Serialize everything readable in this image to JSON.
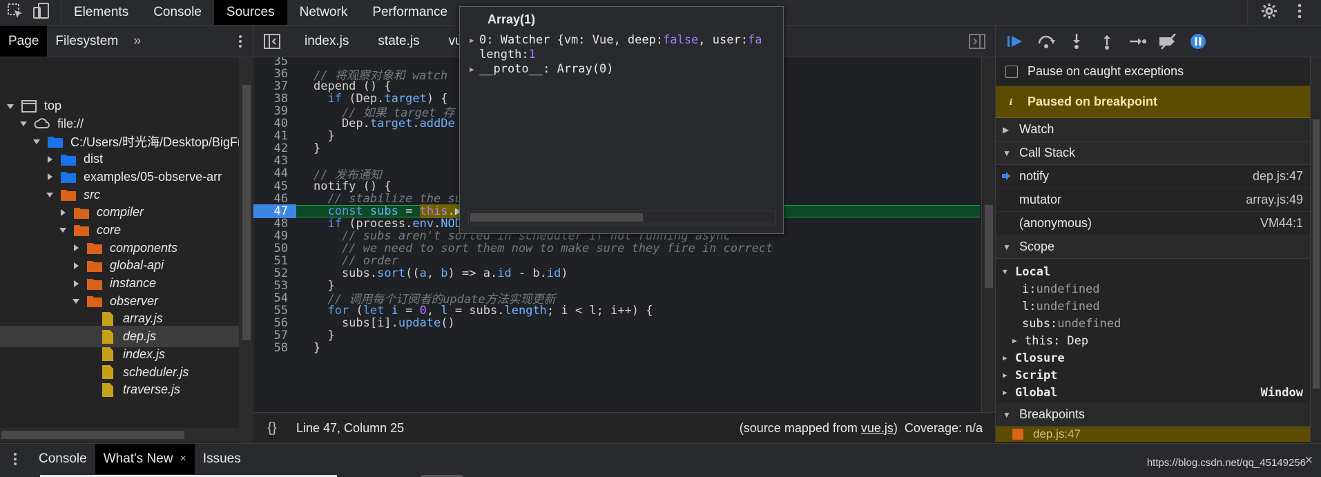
{
  "toolbar": {
    "tabs": [
      "Elements",
      "Console",
      "Sources",
      "Network",
      "Performance"
    ],
    "active_tab": "Sources"
  },
  "navigator": {
    "tabs": [
      "Page",
      "Filesystem"
    ],
    "more": "»",
    "tree": [
      {
        "label": "top",
        "depth": 0,
        "icon": "frame",
        "expanded": true
      },
      {
        "label": "file://",
        "depth": 1,
        "icon": "cloud",
        "expanded": true
      },
      {
        "label": "C:/Users/时光海/Desktop/BigFr",
        "depth": 2,
        "icon": "folder-blue",
        "expanded": true
      },
      {
        "label": "dist",
        "depth": 3,
        "icon": "folder-blue",
        "expanded": false
      },
      {
        "label": "examples/05-observe-arr",
        "depth": 3,
        "icon": "folder-blue",
        "expanded": false
      },
      {
        "label": "src",
        "depth": 3,
        "icon": "folder-orange",
        "expanded": true,
        "italic": true
      },
      {
        "label": "compiler",
        "depth": 4,
        "icon": "folder-orange",
        "expanded": false,
        "italic": true
      },
      {
        "label": "core",
        "depth": 4,
        "icon": "folder-orange",
        "expanded": true,
        "italic": true
      },
      {
        "label": "components",
        "depth": 5,
        "icon": "folder-orange",
        "expanded": false,
        "italic": true
      },
      {
        "label": "global-api",
        "depth": 5,
        "icon": "folder-orange",
        "expanded": false,
        "italic": true
      },
      {
        "label": "instance",
        "depth": 5,
        "icon": "folder-orange",
        "expanded": false,
        "italic": true
      },
      {
        "label": "observer",
        "depth": 5,
        "icon": "folder-orange",
        "expanded": true,
        "italic": true
      },
      {
        "label": "array.js",
        "depth": 6,
        "icon": "file-js",
        "italic": true
      },
      {
        "label": "dep.js",
        "depth": 6,
        "icon": "file-js",
        "italic": true,
        "selected": true
      },
      {
        "label": "index.js",
        "depth": 6,
        "icon": "file-js",
        "italic": true
      },
      {
        "label": "scheduler.js",
        "depth": 6,
        "icon": "file-js",
        "italic": true
      },
      {
        "label": "traverse.js",
        "depth": 6,
        "icon": "file-js",
        "italic": true
      }
    ]
  },
  "editor": {
    "file_tabs": [
      "index.js",
      "state.js",
      "vue"
    ],
    "status": {
      "braces": "{}",
      "position": "Line 47, Column 25",
      "mapped_prefix": "(source mapped from ",
      "mapped_link": "vue.js",
      "mapped_suffix": ")",
      "coverage": "Coverage: n/a"
    },
    "lines": [
      {
        "n": "35",
        "html": "<span class=\"c-cm\"></span>"
      },
      {
        "n": "36",
        "html": "<span class=\"c-cm\">// 将观察对象和 watch</span>"
      },
      {
        "n": "37",
        "html": "depend () {"
      },
      {
        "n": "38",
        "html": "  <span class=\"c-kw2\">if</span> (Dep.<span class=\"c-prop\">target</span>) {"
      },
      {
        "n": "39",
        "html": "    <span class=\"c-cm\">// 如果 target 存</span>"
      },
      {
        "n": "40",
        "html": "    Dep.<span class=\"c-prop\">target</span>.<span class=\"c-prop\">addDe</span>"
      },
      {
        "n": "41",
        "html": "  }"
      },
      {
        "n": "42",
        "html": "}"
      },
      {
        "n": "43",
        "html": ""
      },
      {
        "n": "44",
        "html": "<span class=\"c-cm\">// 发布通知</span>"
      },
      {
        "n": "45",
        "html": "notify () {"
      },
      {
        "n": "46",
        "html": "  <span class=\"c-cm\">// stabilize the subscriber list first</span>"
      },
      {
        "n": "47",
        "html": "  <span class=\"c-kw2\">const</span> <span class=\"c-prop\">subs</span> = <span class=\"c-hl\"><span class=\"c-kw\">this</span>.</span><span class=\"c-hl\">▶<span class=\"c-prop\">subs</span>.</span><span class=\"c-hl\">▶</span>slice()",
        "current": true
      },
      {
        "n": "48",
        "html": "  <span class=\"c-kw2\">if</span> (process.<span class=\"c-prop\">env</span>.<span class=\"c-prop\">NODE_ENV</span> !== <span class=\"c-str\">'production'</span> &amp;&amp; !config.<span class=\"c-prop\">async</span>) {"
      },
      {
        "n": "49",
        "html": "    <span class=\"c-cm\">// subs aren't sorted in scheduler if not running async</span>"
      },
      {
        "n": "50",
        "html": "    <span class=\"c-cm\">// we need to sort them now to make sure they fire in correct</span>"
      },
      {
        "n": "51",
        "html": "    <span class=\"c-cm\">// order</span>"
      },
      {
        "n": "52",
        "html": "    subs.<span class=\"c-prop\">sort</span>((<span class=\"c-prop\">a</span>, <span class=\"c-prop\">b</span>) =&gt; a.<span class=\"c-prop\">id</span> - b.<span class=\"c-prop\">id</span>)"
      },
      {
        "n": "53",
        "html": "  }"
      },
      {
        "n": "54",
        "html": "  <span class=\"c-cm\">// 调用每个订阅者的update方法实现更新</span>"
      },
      {
        "n": "55",
        "html": "  <span class=\"c-kw2\">for</span> (<span class=\"c-kw2\">let</span> <span class=\"c-prop\">i</span> = <span class=\"c-num\">0</span>, <span class=\"c-prop\">l</span> = subs.<span class=\"c-prop\">length</span>; i &lt; l; i++) {"
      },
      {
        "n": "56",
        "html": "    subs[i].<span class=\"c-prop\">update</span>()"
      },
      {
        "n": "57",
        "html": "  }"
      },
      {
        "n": "58",
        "html": "}"
      }
    ]
  },
  "popover": {
    "title": "Array(1)",
    "row0_key": "0: Watcher {vm: Vue, deep: ",
    "row0_false1": "false",
    "row0_mid": ", user: ",
    "row0_false2": "fa",
    "row1_key": "length: ",
    "row1_val": "1",
    "row2": "__proto__: Array(0)"
  },
  "debugger": {
    "pause_on_caught": "Pause on caught exceptions",
    "paused_banner": "Paused on breakpoint",
    "info_glyph": "i",
    "watch": "Watch",
    "call_stack": "Call Stack",
    "stack": [
      {
        "fn": "notify",
        "loc": "dep.js:47",
        "current": true
      },
      {
        "fn": "mutator",
        "loc": "array.js:49"
      },
      {
        "fn": "(anonymous)",
        "loc": "VM44:1"
      }
    ],
    "scope": "Scope",
    "local": "Local",
    "locals": [
      {
        "k": "i: ",
        "v": "undefined"
      },
      {
        "k": "l: ",
        "v": "undefined"
      },
      {
        "k": "subs: ",
        "v": "undefined"
      }
    ],
    "this_row": "this: Dep",
    "closure": "Closure",
    "script": "Script",
    "global": "Global",
    "global_val": "Window",
    "breakpoints": "Breakpoints",
    "bp_item": "dep.js:47"
  },
  "drawer": {
    "tabs": [
      "Console",
      "What's New",
      "Issues"
    ],
    "active_tab": "What's New",
    "close_glyph": "×",
    "watermark": "https://blog.csdn.net/qq_45149256"
  },
  "colors": {
    "accent": "#3b86e5",
    "paused_banner": "#5c4c00",
    "folder_blue": "#1a73e8",
    "folder_orange": "#d9631a",
    "file_js": "#c8a11b"
  }
}
